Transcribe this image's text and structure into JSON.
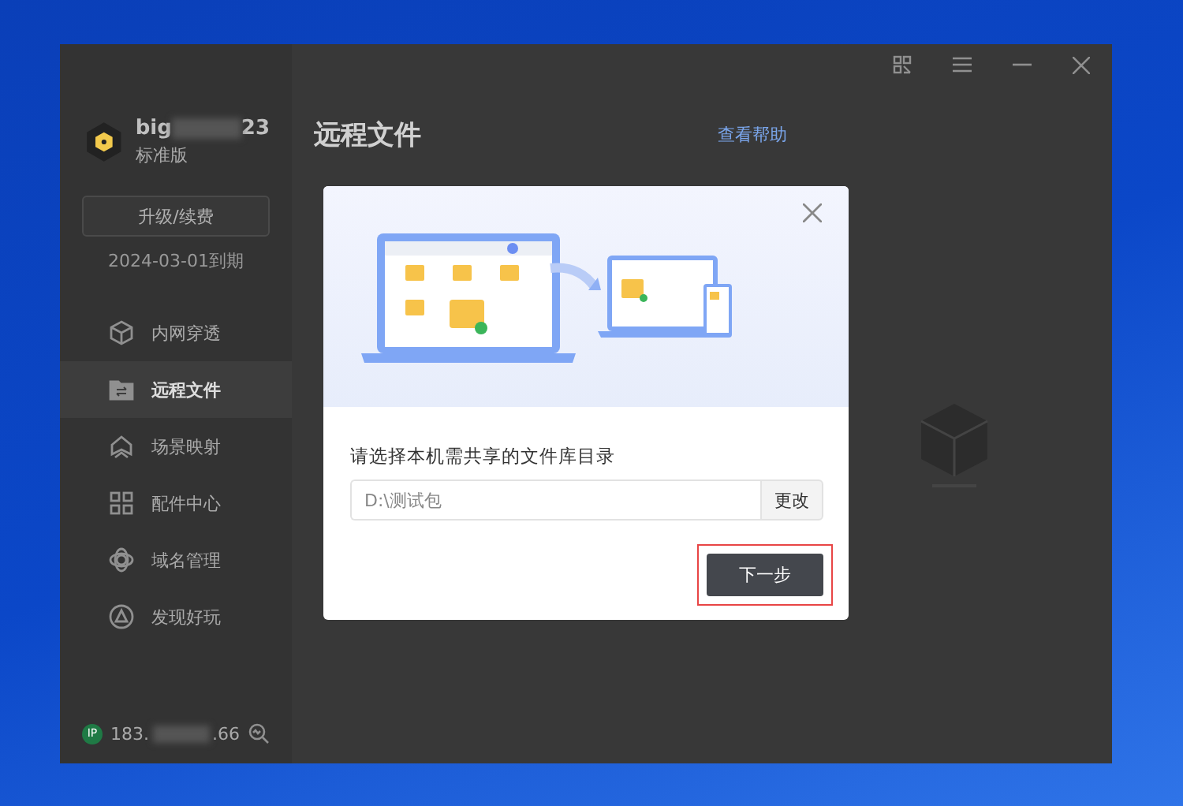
{
  "window": {
    "controls": [
      {
        "kind": "apps"
      },
      {
        "kind": "menu"
      },
      {
        "kind": "minimize"
      },
      {
        "kind": "close"
      }
    ]
  },
  "account": {
    "name_start": "big",
    "name_end": "23",
    "edition": "标准版",
    "upgrade_button": "升级/续费",
    "expiry": "2024-03-01到期"
  },
  "sidebar": {
    "items": [
      {
        "label": "内网穿透",
        "selected": false
      },
      {
        "label": "远程文件",
        "selected": true
      },
      {
        "label": "场景映射",
        "selected": false
      },
      {
        "label": "配件中心",
        "selected": false
      },
      {
        "label": "域名管理",
        "selected": false
      },
      {
        "label": "发现好玩",
        "selected": false
      }
    ]
  },
  "status": {
    "ip_badge": "IP",
    "ip_start": "183.",
    "ip_end": ".66"
  },
  "main": {
    "title": "远程文件",
    "help_link": "查看帮助"
  },
  "dialog": {
    "prompt": "请选择本机需共享的文件库目录",
    "path_placeholder": "D:\\测试包",
    "change_button": "更改",
    "next_button": "下一步",
    "next_highlighted": true
  }
}
